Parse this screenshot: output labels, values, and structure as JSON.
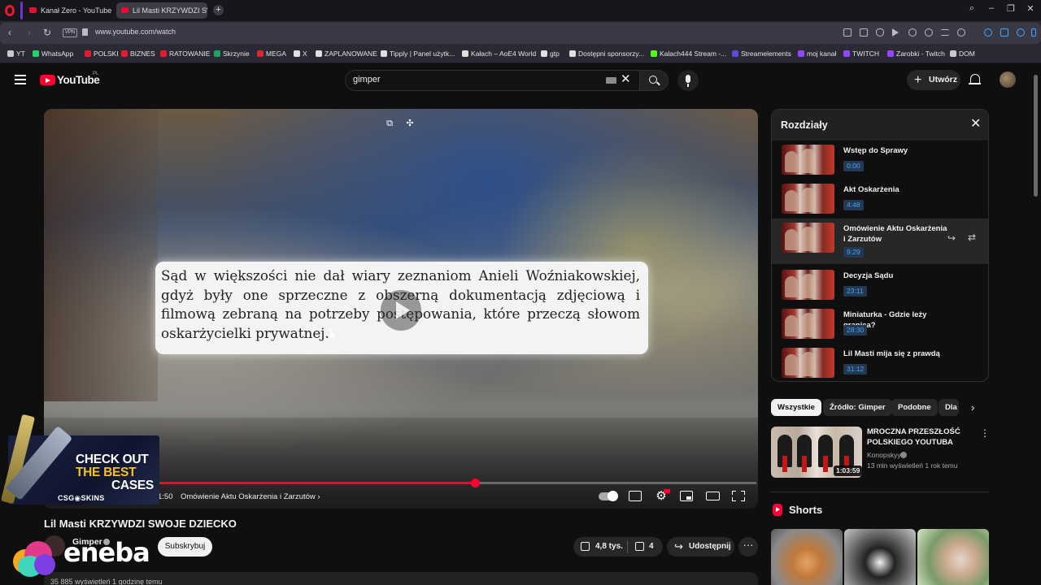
{
  "browser": {
    "tabs": [
      {
        "label": "Kanał Zero - YouTube",
        "active": false
      },
      {
        "label": "Lil Masti KRZYWDZI SWO",
        "active": true
      }
    ],
    "url": "www.youtube.com/watch",
    "vpn_label": "VPN",
    "bookmarks": [
      {
        "label": "YT",
        "icon": "folder-icon",
        "color": "#c8c8d0"
      },
      {
        "label": "WhatsApp",
        "icon": "whatsapp-icon",
        "color": "#25d366"
      },
      {
        "label": "POLSKI",
        "icon": "flag-icon",
        "color": "#e8192c"
      },
      {
        "label": "BIZNES",
        "icon": "flag-icon",
        "color": "#e8192c"
      },
      {
        "label": "RATOWANIE",
        "icon": "flag-icon",
        "color": "#e8192c"
      },
      {
        "label": "Skrzynie",
        "icon": "sheets-icon",
        "color": "#1fa463"
      },
      {
        "label": "MEGA",
        "icon": "mega-icon",
        "color": "#d9272e"
      },
      {
        "label": "X",
        "icon": "x-icon",
        "color": "#e0e0e0"
      },
      {
        "label": "ZAPLANOWANE",
        "icon": "x-icon",
        "color": "#e0e0e0"
      },
      {
        "label": "Tipply | Panel użytk...",
        "icon": "tipply-icon",
        "color": "#e0e0e0"
      },
      {
        "label": "Kałach – AoE4 World",
        "icon": "w-icon",
        "color": "#e0e0e0"
      },
      {
        "label": "gtp",
        "icon": "openai-icon",
        "color": "#e0e0e0"
      },
      {
        "label": "Dostępni sponsorzy...",
        "icon": "page-icon",
        "color": "#e0e0e0"
      },
      {
        "label": "Kalach444 Stream -...",
        "icon": "k-icon",
        "color": "#53fc18"
      },
      {
        "label": "Streamelements",
        "icon": "streamelements-icon",
        "color": "#5c4bd8"
      },
      {
        "label": "moj kanał",
        "icon": "twitch-icon",
        "color": "#9146ff"
      },
      {
        "label": "TWITCH",
        "icon": "twitch-icon",
        "color": "#9146ff"
      },
      {
        "label": "Zarobki - Twitch",
        "icon": "twitch-icon",
        "color": "#9146ff"
      },
      {
        "label": "DOM",
        "icon": "folder-icon",
        "color": "#c8c8d0"
      }
    ]
  },
  "youtube": {
    "logo_text": "YouTube",
    "region": "PL",
    "search_value": "gimper",
    "create_label": "Utwórz"
  },
  "player": {
    "subtitle": "Sąd w większości nie dał wiary zeznaniom Anieli Woźniakowskiej, gdyż były one sprzeczne z obszerną dokumentacją zdjęciową i filmową zebraną na potrzeby postępowania, które przeczą słowom oskarżycielki prywatnej.",
    "time": "1:50",
    "chapter": "Omówienie Aktu Oskarżenia i Zarzutów",
    "progress": 0.53
  },
  "video": {
    "title": "Lil Masti KRZYWDZI SWOJE DZIECKO",
    "channel": "Gimper",
    "subscribe_label": "Subskrybuj",
    "likes": "4,8 tys.",
    "dislikes": "4",
    "share_label": "Udostępnij",
    "views": "35 885 wyświetleń  1 godzinę temu"
  },
  "ads": {
    "csgo_lines": [
      "CHECK OUT",
      "THE BEST",
      "CASES"
    ],
    "csgo_brand": "CSG◉SKINS",
    "eneba": "eneba"
  },
  "chapters": {
    "title": "Rozdziały",
    "items": [
      {
        "title": "Wstęp do Sprawy",
        "time": "0:00"
      },
      {
        "title": "Akt Oskarżenia",
        "time": "4:48"
      },
      {
        "title": "Omówienie Aktu Oskarżenia i Zarzutów",
        "time": "9:29"
      },
      {
        "title": "Decyzja Sądu",
        "time": "23:11"
      },
      {
        "title": "Miniaturka - Gdzie leży granica?",
        "time": "28:30"
      },
      {
        "title": "Lil Masti mija się z prawdą",
        "time": "31:12"
      }
    ]
  },
  "chips": [
    "Wszystkie",
    "Źródło: Gimper",
    "Podobne",
    "Dla"
  ],
  "recommended": {
    "title": "MROCZNA PRZESZŁOŚĆ POLSKIEGO YOUTUBA",
    "channel": "Konopskyy",
    "meta": "13 mln wyświetleń  1 rok temu",
    "duration": "1:03:59"
  },
  "shorts_title": "Shorts",
  "colors": {
    "accent": "#ff0033",
    "chapter_time": "#3ea6ff"
  }
}
